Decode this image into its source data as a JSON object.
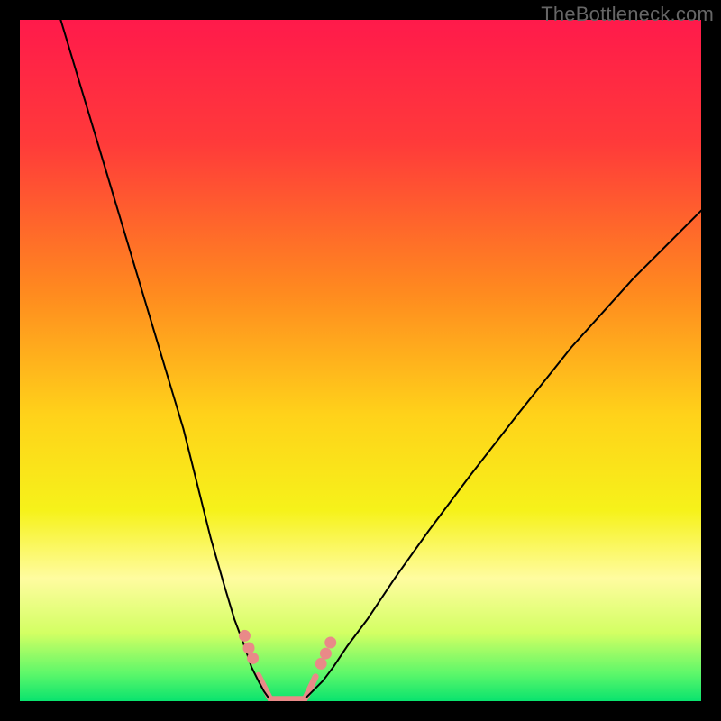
{
  "watermark": "TheBottleneck.com",
  "chart_data": {
    "type": "line",
    "title": "",
    "xlabel": "",
    "ylabel": "",
    "xlim": [
      0,
      100
    ],
    "ylim": [
      0,
      100
    ],
    "background_gradient": [
      {
        "stop": 0.0,
        "color": "#ff1a4b"
      },
      {
        "stop": 0.18,
        "color": "#ff3a3a"
      },
      {
        "stop": 0.4,
        "color": "#ff8a1f"
      },
      {
        "stop": 0.58,
        "color": "#ffd21a"
      },
      {
        "stop": 0.72,
        "color": "#f6f21a"
      },
      {
        "stop": 0.82,
        "color": "#fffca0"
      },
      {
        "stop": 0.9,
        "color": "#d3ff63"
      },
      {
        "stop": 0.96,
        "color": "#5cf76a"
      },
      {
        "stop": 1.0,
        "color": "#09e36e"
      }
    ],
    "series": [
      {
        "name": "left-curve",
        "color": "#000000",
        "width": 2,
        "x": [
          6,
          9,
          12,
          15,
          18,
          21,
          24,
          26,
          28,
          30,
          31.5,
          33,
          34,
          35,
          35.8,
          36.5
        ],
        "y": [
          100,
          90,
          80,
          70,
          60,
          50,
          40,
          32,
          24,
          17,
          12,
          8,
          5,
          3,
          1.5,
          0.5
        ]
      },
      {
        "name": "right-curve",
        "color": "#000000",
        "width": 2,
        "x": [
          42,
          43,
          44.5,
          46,
          48,
          51,
          55,
          60,
          66,
          73,
          81,
          90,
          100
        ],
        "y": [
          0.5,
          1.5,
          3,
          5,
          8,
          12,
          18,
          25,
          33,
          42,
          52,
          62,
          72
        ]
      }
    ],
    "bottom_segments": {
      "color": "#e98a88",
      "width": 7,
      "linecap": "round",
      "parts": [
        {
          "x": [
            35.0,
            36.6
          ],
          "y": [
            3.8,
            0.6
          ]
        },
        {
          "x": [
            36.8,
            41.8
          ],
          "y": [
            0.3,
            0.3
          ]
        },
        {
          "x": [
            42.0,
            43.4
          ],
          "y": [
            0.6,
            3.6
          ]
        }
      ]
    },
    "threshold_dots": {
      "color": "#e98a88",
      "radius": 6.5,
      "points": [
        {
          "x": 33.0,
          "y": 9.6
        },
        {
          "x": 33.6,
          "y": 7.8
        },
        {
          "x": 34.2,
          "y": 6.3
        },
        {
          "x": 44.2,
          "y": 5.5
        },
        {
          "x": 44.9,
          "y": 7.0
        },
        {
          "x": 45.6,
          "y": 8.6
        }
      ]
    }
  }
}
